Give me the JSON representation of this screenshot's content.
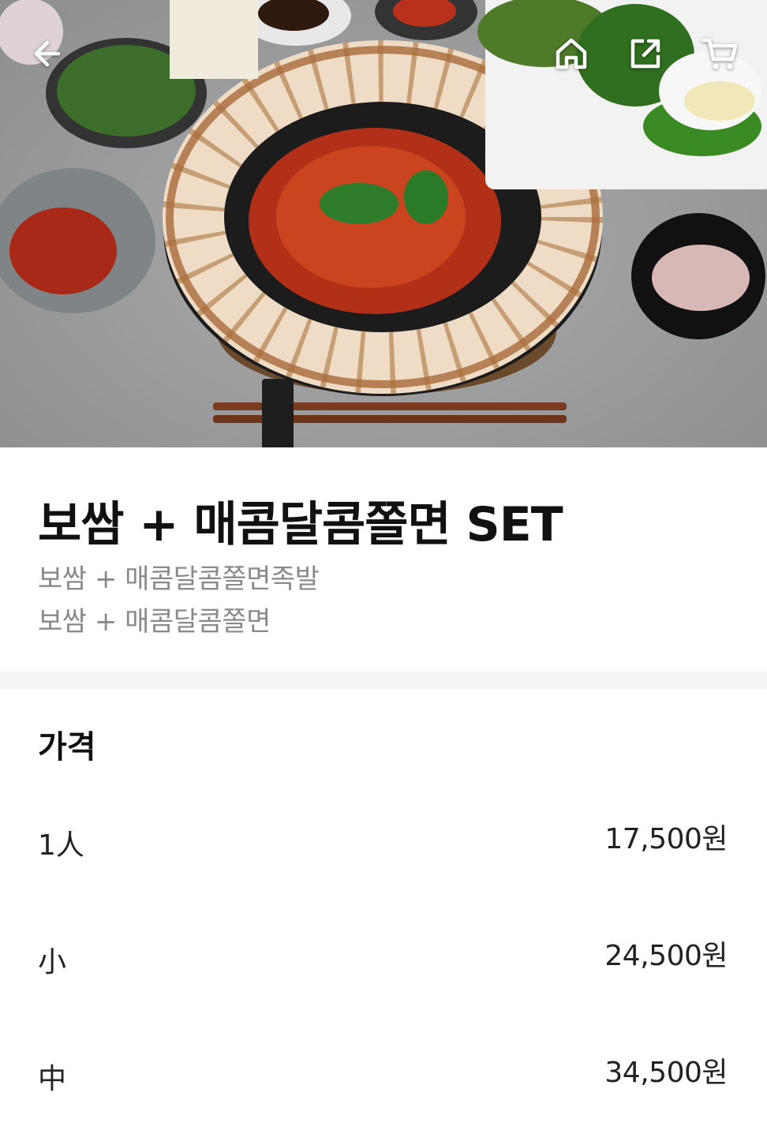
{
  "header": {
    "back_icon": "arrow-left-icon",
    "home_icon": "home-icon",
    "share_icon": "share-icon",
    "cart_icon": "cart-icon"
  },
  "product": {
    "title": "보쌈 + 매콤달콤쫄면 SET",
    "description_lines": [
      "보쌈 + 매콤달콤쫄면족발",
      "보쌈 + 매콤달콤쫄면"
    ]
  },
  "price_section": {
    "title": "가격",
    "rows": [
      {
        "label": "1人",
        "price": "17,500원"
      },
      {
        "label": "小",
        "price": "24,500원"
      },
      {
        "label": "中",
        "price": "34,500원"
      }
    ]
  },
  "colors": {
    "title": "#111111",
    "description": "#8a8a8a",
    "divider": "#f3f4f6"
  }
}
